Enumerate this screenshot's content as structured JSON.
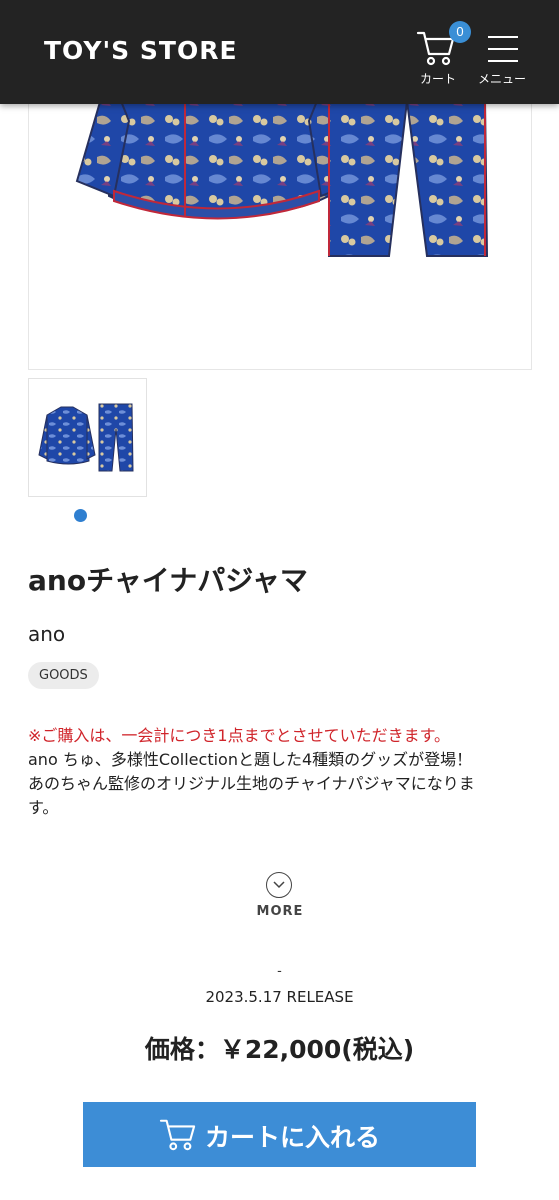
{
  "header": {
    "logo": "TOY'S STORE",
    "cart_count": "0",
    "cart_label": "カート",
    "menu_label": "メニュー"
  },
  "product": {
    "title": "anoチャイナパジャマ",
    "artist": "ano",
    "tag": "GOODS",
    "notice": "※ご購入は、一会計につき1点までとさせていただきます。",
    "description": [
      "ano ちゅ、多様性Collectionと題した4種類のグッズが登場！",
      "あのちゃん監修のオリジナル生地のチャイナパジャマになりま",
      "す。"
    ],
    "more_label": "MORE",
    "dash": "-",
    "release": "2023.5.17 RELEASE",
    "price": "価格：￥22,000(税込)",
    "add_to_cart": "カートに入れる"
  },
  "colors": {
    "header_bg": "#232323",
    "accent_blue": "#3d8dd6",
    "notice_red": "#d0252b",
    "pajama_blue": "#1f47a8"
  },
  "icons": [
    "cart-icon",
    "menu-icon",
    "chevron-down-icon"
  ]
}
